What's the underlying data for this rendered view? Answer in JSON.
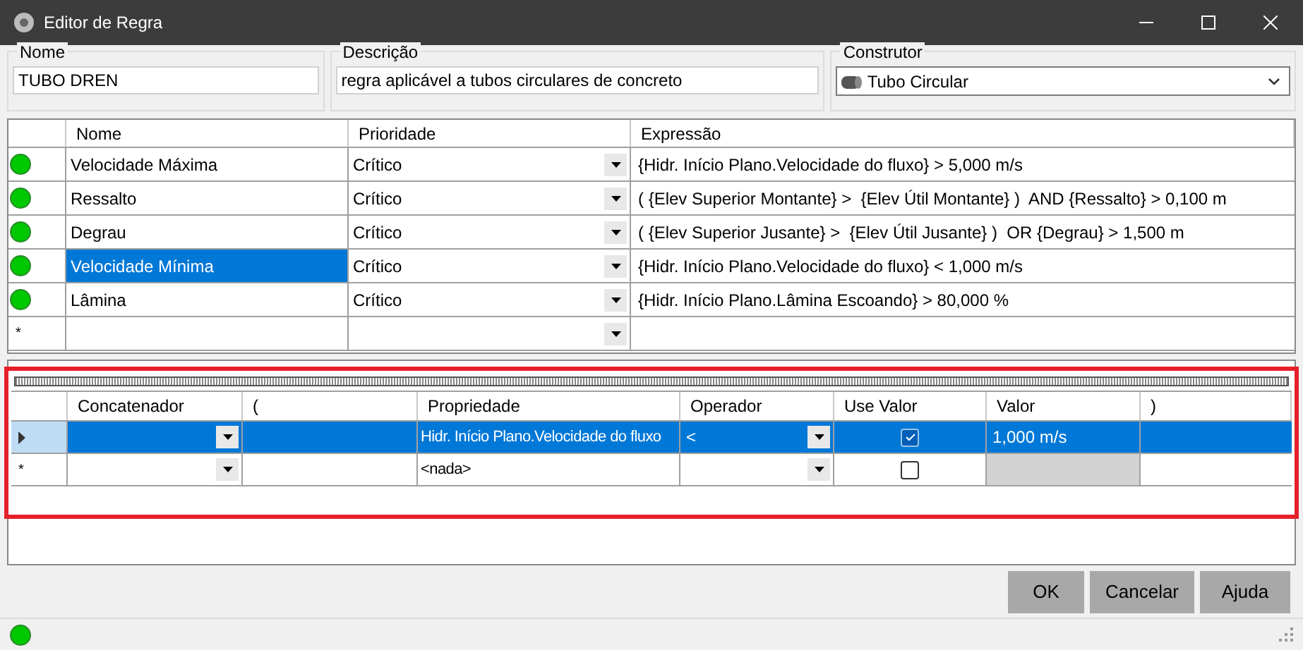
{
  "window": {
    "title": "Editor de Regra"
  },
  "fields": [
    {
      "label": "Nome",
      "value": "TUBO DREN",
      "kind": "text"
    },
    {
      "label": "Descrição",
      "value": "regra aplicável a tubos circulares de concreto",
      "kind": "text"
    },
    {
      "label": "Construtor",
      "value": "Tubo Circular",
      "kind": "combo"
    }
  ],
  "rules": {
    "columns": [
      "Nome",
      "Prioridade",
      "Expressão"
    ],
    "rows": [
      {
        "color": "#00c800",
        "name": "Velocidade Máxima",
        "priority": "Crítico",
        "expression": "{Hidr. Início Plano.Velocidade do fluxo} > 5,000 m/s",
        "selected": false
      },
      {
        "color": "#00c800",
        "name": "Ressalto",
        "priority": "Crítico",
        "expression": "( {Elev Superior Montante} >  {Elev Útil Montante} )  AND {Ressalto} > 0,100 m",
        "selected": false
      },
      {
        "color": "#00c800",
        "name": "Degrau",
        "priority": "Crítico",
        "expression": "( {Elev Superior Jusante} >  {Elev Útil Jusante} )  OR {Degrau} > 1,500 m",
        "selected": false
      },
      {
        "color": "#00c800",
        "name": "Velocidade Mínima",
        "priority": "Crítico",
        "expression": "{Hidr. Início Plano.Velocidade do fluxo} < 1,000 m/s",
        "selected": true
      },
      {
        "color": "#00c800",
        "name": "Lâmina",
        "priority": "Crítico",
        "expression": "{Hidr. Início Plano.Lâmina Escoando} > 80,000 %",
        "selected": false
      }
    ],
    "new_row_marker": "*"
  },
  "conditions": {
    "columns": [
      "Concatenador",
      "(",
      "Propriedade",
      "Operador",
      "Use Valor",
      "Valor",
      ")"
    ],
    "rows": [
      {
        "kind": "current",
        "selected": true,
        "property": "Hidr. Início Plano.Velocidade do fluxo",
        "operator": "<",
        "use_value": true,
        "value": "1,000 m/s",
        "value_disabled": false
      },
      {
        "kind": "new",
        "marker": "*",
        "selected": false,
        "property": "<nada>",
        "use_value": false,
        "value_disabled": true
      }
    ]
  },
  "buttons": [
    "OK",
    "Cancelar",
    "Ajuda"
  ],
  "status_bar": {
    "color": "#00c800"
  }
}
